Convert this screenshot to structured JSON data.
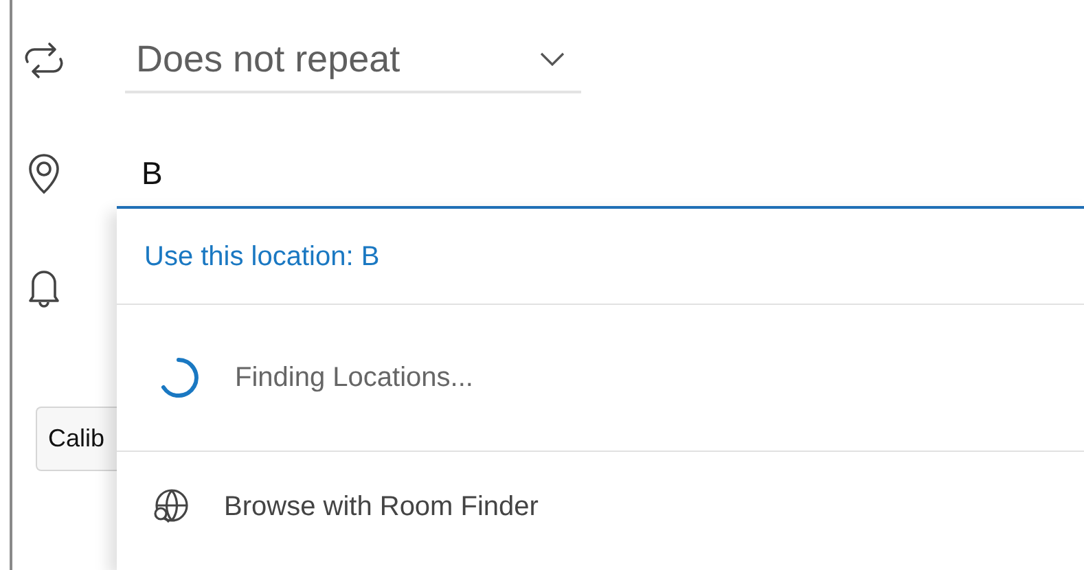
{
  "repeat": {
    "value": "Does not repeat"
  },
  "location": {
    "value": "B"
  },
  "font_picker": {
    "value": "Calib"
  },
  "suggestions": [
    {
      "kind": "action",
      "label": "Use this location: B"
    },
    {
      "kind": "loading",
      "label": "Finding Locations..."
    },
    {
      "kind": "browse",
      "label": "Browse with Room Finder"
    }
  ]
}
